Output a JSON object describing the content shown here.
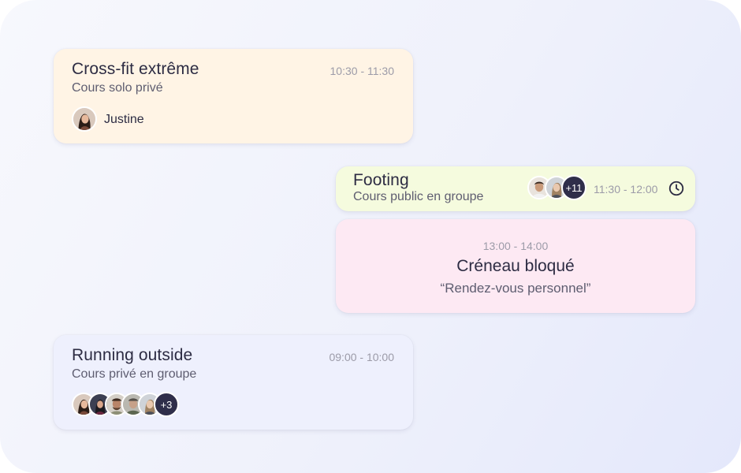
{
  "events": {
    "crossfit": {
      "title": "Cross-fit extrême",
      "subtitle": "Cours solo privé",
      "time": "10:30 - 11:30",
      "participant": "Justine"
    },
    "footing": {
      "title": "Footing",
      "subtitle": "Cours public en groupe",
      "time": "11:30 - 12:00",
      "more_count": "+11",
      "icon": "clock-icon"
    },
    "blocked": {
      "time": "13:00 - 14:00",
      "title": "Créneau bloqué",
      "note": "“Rendez-vous personnel”"
    },
    "running": {
      "title": "Running outside",
      "subtitle": "Cours privé en groupe",
      "time": "09:00 - 10:00",
      "more_count": "+3"
    }
  },
  "colors": {
    "crossfit_bg": "#fff4e5",
    "footing_bg": "#f5fbde",
    "blocked_bg": "#fde9f3",
    "running_bg": "#eef0fd",
    "badge_bg": "#2f2e4a",
    "text_primary": "#2d2c43",
    "text_muted": "#9c9ba8"
  }
}
